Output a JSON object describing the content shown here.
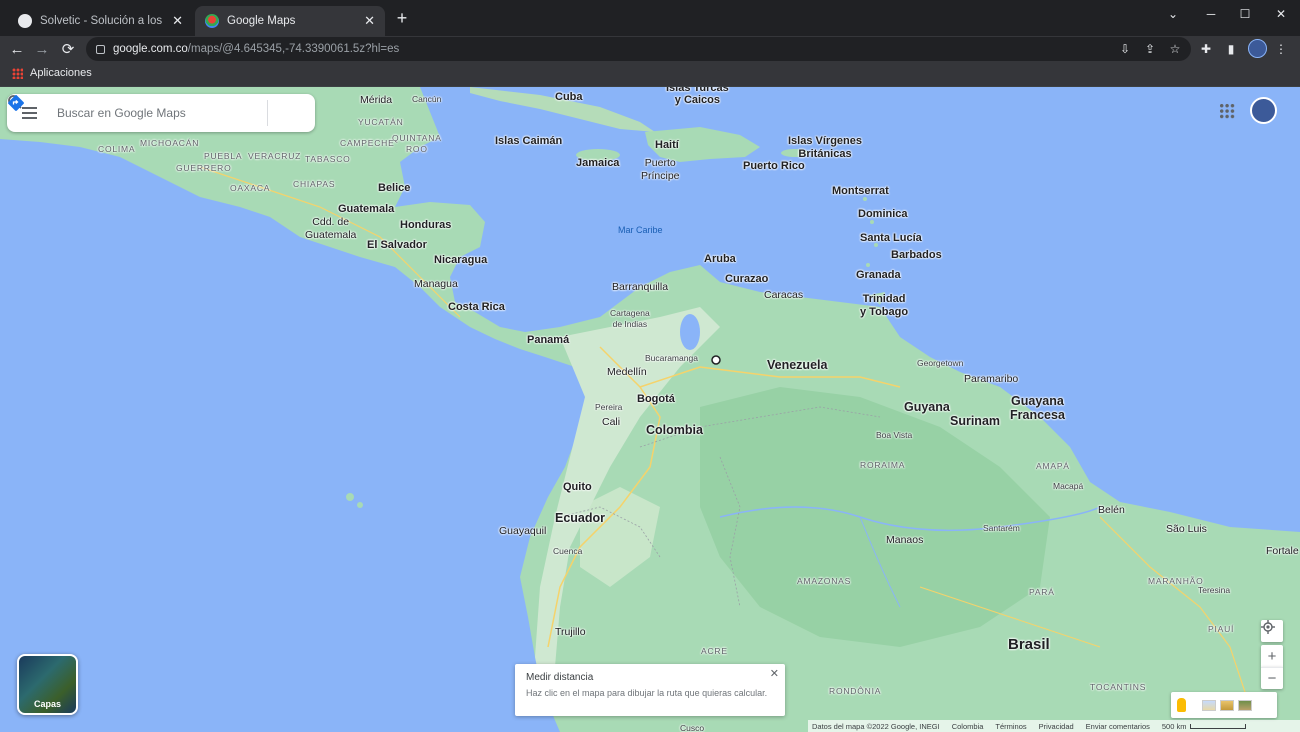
{
  "browser": {
    "tabs": [
      {
        "title": "Solvetic - Solución a los problemas",
        "favicon": "solvetic-icon",
        "active": false
      },
      {
        "title": "Google Maps",
        "favicon": "google-maps-icon",
        "active": true
      }
    ],
    "new_tab": "+",
    "window_controls": {
      "minimize": "─",
      "maximize": "☐",
      "close": "✕",
      "tab_list": "⌄"
    },
    "url_host": "google.com.co",
    "url_path": "/maps/@4.645345,-74.3390061.5z?hl=es",
    "bookmarks": [
      {
        "label": "Aplicaciones"
      }
    ]
  },
  "search": {
    "placeholder": "Buscar en Google Maps"
  },
  "map_labels": {
    "cities": {
      "merida": "Mérida",
      "cancun": "Cancún",
      "belice": "Belice",
      "guatemala": "Guatemala",
      "cdd_guatemala": "Cdd. de\nGuatemala",
      "el_salvador": "El Salvador",
      "honduras": "Honduras",
      "managua": "Managua",
      "nicaragua": "Nicaragua",
      "costa_rica": "Costa Rica",
      "panama": "Panamá",
      "cuba": "Cuba",
      "islas_turcas": "Islas Turcas\ny Caicos",
      "islas_caiman": "Islas Caimán",
      "jamaica": "Jamaica",
      "haiti": "Haití",
      "puerto_principe": "Puerto\nPríncipe",
      "puerto_rico": "Puerto Rico",
      "islas_virgenes": "Islas Vírgenes\nBritánicas",
      "montserrat": "Montserrat",
      "dominica": "Dominica",
      "santa_lucia": "Santa Lucía",
      "barbados": "Barbados",
      "granada": "Granada",
      "trinidad": "Trinidad\ny Tobago",
      "aruba": "Aruba",
      "curazao": "Curazao",
      "barranquilla": "Barranquilla",
      "cartagena": "Cartagena\nde Indias",
      "caracas": "Caracas",
      "bucaramanga": "Bucaramanga",
      "medellin": "Medellín",
      "pereira": "Pereira",
      "bogota": "Bogotá",
      "cali": "Cali",
      "quito": "Quito",
      "guayaquil": "Guayaquil",
      "cuenca": "Cuenca",
      "trujillo": "Trujillo",
      "georgetown": "Georgetown",
      "paramaribo": "Paramaribo",
      "boa_vista": "Boa Vista",
      "macapa": "Macapá",
      "belen": "Belén",
      "sao_luis": "São Luis",
      "fortaleza": "Fortale",
      "manaos": "Manaos",
      "santarem": "Santarém",
      "teresina": "Teresina",
      "cusco": "Cusco"
    },
    "countries": {
      "venezuela": "Venezuela",
      "colombia": "Colombia",
      "ecuador": "Ecuador",
      "guyana": "Guyana",
      "surinam": "Surinam",
      "guayana_francesa": "Guayana\nFrancesa",
      "brasil": "Brasil"
    },
    "regions": {
      "yucatan": "YUCATÁN",
      "quintana_roo": "QUINTANA\nROO",
      "campeche": "CAMPECHE",
      "tabasco": "TABASCO",
      "chiapas": "CHIAPAS",
      "oaxaca": "OAXACA",
      "guerrero": "GUERRERO",
      "puebla": "PUEBLA",
      "veracruz": "VERACRUZ",
      "michoacan": "MICHOACÁN",
      "colima": "COLIMA",
      "roraima": "RORAIMA",
      "amapa": "AMAPÁ",
      "amazonas": "AMAZONAS",
      "para": "PARÁ",
      "maranhao": "MARANHÃO",
      "piaui": "PIAUÍ",
      "acre": "ACRE",
      "rondonia": "RONDÔNIA",
      "tocantins": "TOCANTINS"
    },
    "sea": "Mar Caribe"
  },
  "layers_button": {
    "label": "Capas"
  },
  "measure_toast": {
    "title": "Medir distancia",
    "hint": "Haz clic en el mapa para dibujar la ruta que quieras calcular."
  },
  "controls": {
    "zoom_in": "+",
    "zoom_out": "−"
  },
  "footer": {
    "data_credit": "Datos del mapa ©2022 Google, INEGI",
    "region": "Colombia",
    "terms": "Términos",
    "privacy": "Privacidad",
    "feedback": "Enviar comentarios",
    "scale": "500 km"
  },
  "colors": {
    "water": "#8ab4f8",
    "land": "#a8dab5",
    "chrome_dark": "#202124",
    "chrome_toolbar": "#35363a",
    "accent_blue": "#1a73e8"
  }
}
